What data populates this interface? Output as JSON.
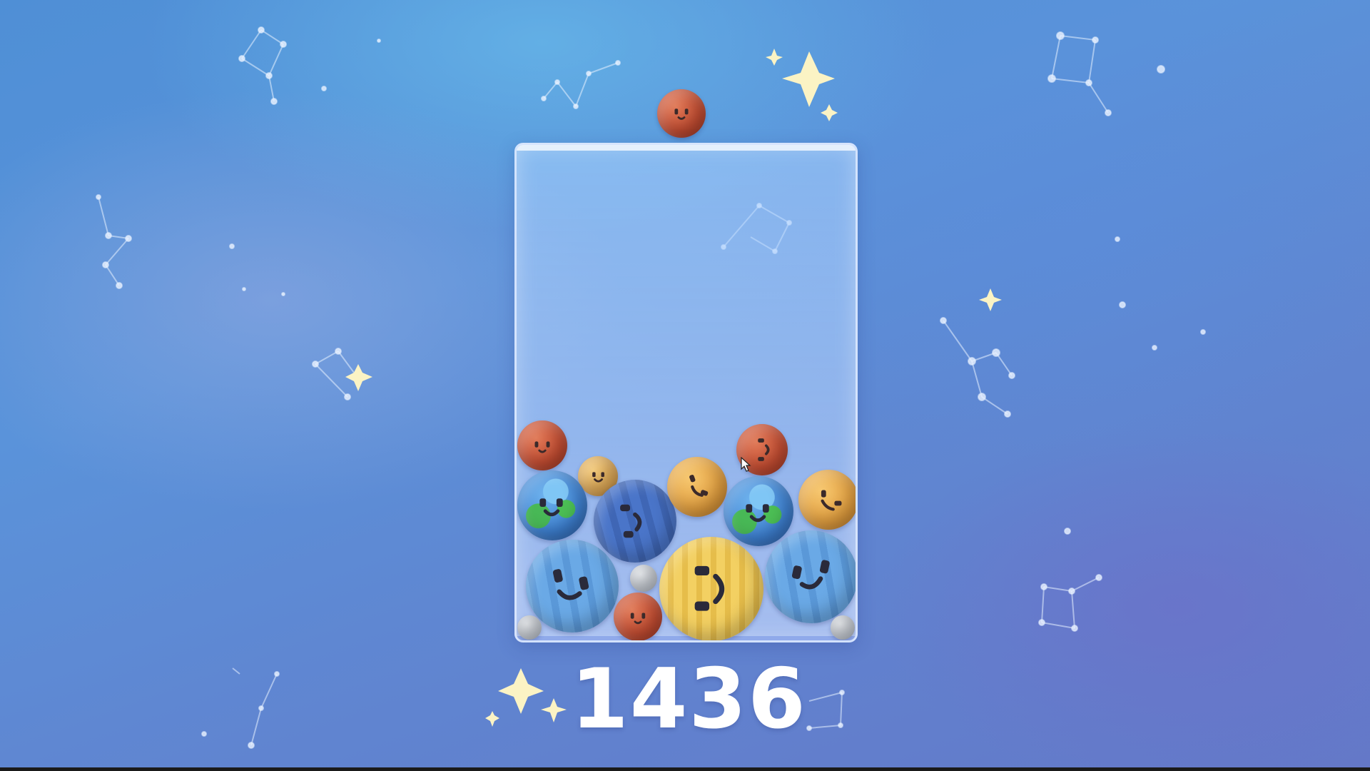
{
  "game": {
    "score": "1436",
    "next_planet": "mars"
  },
  "colors": {
    "mars": "#c54e33",
    "mercury": "#dba553",
    "venus": "#e09d3e",
    "earth": "#3d7fcf",
    "neptune": "#4a75c9",
    "uranus": "#6aa9e6",
    "saturn": "#f3d062",
    "moon": "#bfc5ce",
    "star": "#fbf3c4",
    "score_text": "#ffffff"
  },
  "jar_planets": [
    {
      "type": "mars"
    },
    {
      "type": "mercury"
    },
    {
      "type": "earth"
    },
    {
      "type": "neptune"
    },
    {
      "type": "venus"
    },
    {
      "type": "mars"
    },
    {
      "type": "earth"
    },
    {
      "type": "venus"
    },
    {
      "type": "uranus"
    },
    {
      "type": "moon"
    },
    {
      "type": "mars"
    },
    {
      "type": "saturn"
    },
    {
      "type": "uranus"
    },
    {
      "type": "moon"
    },
    {
      "type": "moon"
    }
  ]
}
